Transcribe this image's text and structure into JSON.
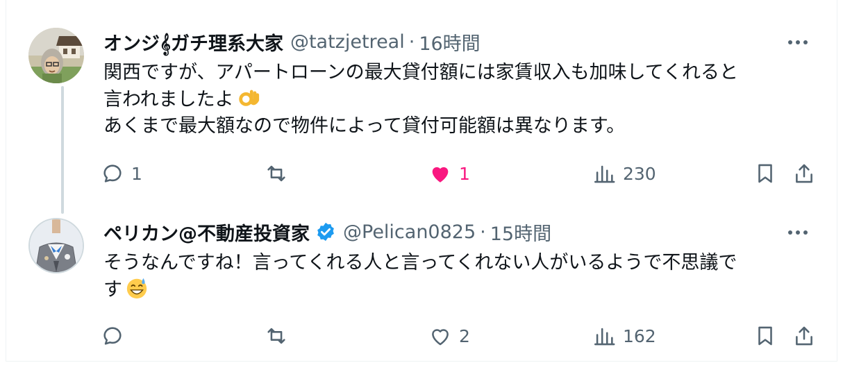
{
  "posts": [
    {
      "name": "オンジ𝄞ガチ理系大家",
      "handle": "@tatzjetreal",
      "separator": "·",
      "time": "16時間",
      "text_lines": [
        "関西ですが、アパートローンの最大貸付額には家賃収入も加味してくれると",
        "言われましたよ",
        "あくまで最大額なので物件によって貸付可能額は異なります。"
      ],
      "emoji": "ok-hand",
      "actions": {
        "replies": "1",
        "reposts": "",
        "likes": "1",
        "views": "230"
      },
      "liked": true,
      "verified": false
    },
    {
      "name": "ペリカン@不動産投資家",
      "handle": "@Pelican0825",
      "separator": "·",
      "time": "15時間",
      "text_lines": [
        "そうなんですね！言ってくれる人と言ってくれない人がいるようで不思議で",
        "す"
      ],
      "emoji": "grinning-sweat",
      "actions": {
        "replies": "",
        "reposts": "",
        "likes": "2",
        "views": "162"
      },
      "liked": false,
      "verified": true
    }
  ],
  "colors": {
    "text": "#0f1419",
    "secondary": "#536471",
    "like": "#f91880",
    "verified": "#1d9bf0",
    "divider": "#eff3f4",
    "thread_line": "#cfd9de"
  }
}
